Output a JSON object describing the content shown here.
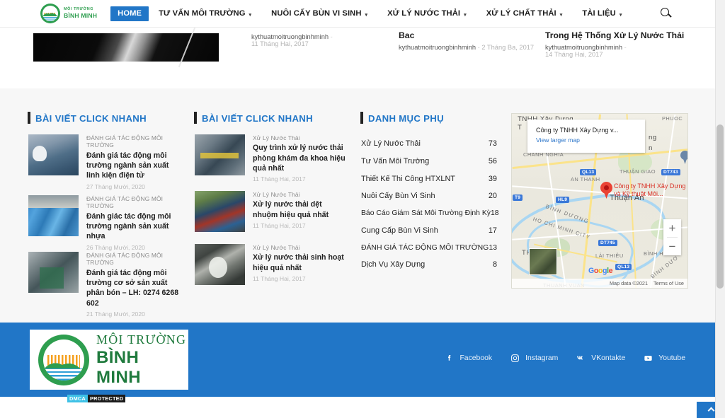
{
  "header": {
    "logo": {
      "line1": "MÔI TRƯỜNG",
      "line2": "BÌNH MINH"
    },
    "nav": [
      {
        "label": "HOME",
        "active": true,
        "caret": ""
      },
      {
        "label": "TƯ VẤN MÔI TRƯỜNG",
        "active": false,
        "caret": "▾"
      },
      {
        "label": "NUÔI CẤY BÙN VI SINH",
        "active": false,
        "caret": "▾"
      },
      {
        "label": "XỬ LÝ NƯỚC THẢI",
        "active": false,
        "caret": "▾"
      },
      {
        "label": "XỬ LÝ CHẤT THẢI",
        "active": false,
        "caret": "▾"
      },
      {
        "label": "TÀI LIỆU",
        "active": false,
        "caret": "▾"
      }
    ],
    "search_icon": "search-icon"
  },
  "top_posts": [
    {
      "author": "kythuatmoitruongbinhminh",
      "sep": "-",
      "date": "11 Tháng Hai, 2017"
    },
    {
      "title_fragment": "Bac",
      "author": "kythuatmoitruongbinhminh",
      "sep": "-",
      "date": "2 Tháng Ba, 2017"
    },
    {
      "title_fragment": "Trong Hệ Thống Xử Lý Nước Thải",
      "author": "kythuatmoitruongbinhminh",
      "sep": "-",
      "date": "14 Tháng Hai, 2017"
    }
  ],
  "widget_col1": {
    "title": "BÀI VIẾT CLICK NHANH",
    "posts": [
      {
        "category": "ĐÁNH GIÁ TÁC ĐỘNG MÔI TRƯỜNG",
        "title": "Đánh giá tác động môi trường ngành sản xuất linh kiện điện tử",
        "date": "27 Tháng Mười, 2020"
      },
      {
        "category": "ĐÁNH GIÁ TÁC ĐỘNG MÔI TRƯỜNG",
        "title": "Đánh giác tác động môi trường ngành sản xuất nhựa",
        "date": "26 Tháng Mười, 2020"
      },
      {
        "category": "ĐÁNH GIÁ TÁC ĐỘNG MÔI TRƯỜNG",
        "title": "Đánh giá tác động môi trường cơ sở sản xuất phân bón – LH: 0274 6268 602",
        "date": "21 Tháng Mười, 2020"
      }
    ]
  },
  "widget_col2": {
    "title": "BÀI VIẾT CLICK NHANH",
    "posts": [
      {
        "category": "Xử Lý Nước Thải",
        "title": "Quy trình xử lý nước thải phòng khám đa khoa hiệu quả nhất",
        "date": "11 Tháng Hai, 2017"
      },
      {
        "category": "Xử Lý Nước Thải",
        "title": "Xử lý nước thải dệt nhuộm hiệu quả nhất",
        "date": "11 Tháng Hai, 2017"
      },
      {
        "category": "Xử Lý Nước Thải",
        "title": "Xử lý nước thải sinh hoạt hiệu quả nhất",
        "date": "11 Tháng Hai, 2017"
      }
    ]
  },
  "widget_col3": {
    "title": "DANH MỤC PHỤ",
    "categories": [
      {
        "name": "Xử Lý Nước Thải",
        "count": "73"
      },
      {
        "name": "Tư Vấn Môi Trường",
        "count": "56"
      },
      {
        "name": "Thiết Kế Thi Công HTXLNT",
        "count": "39"
      },
      {
        "name": "Nuôi Cấy Bùn Vi Sinh",
        "count": "20"
      },
      {
        "name": "Báo Cáo Giám Sát Môi Trường Định Kỳ",
        "count": "18"
      },
      {
        "name": "Cung Cấp Bùn Vi Sinh",
        "count": "17"
      },
      {
        "name": "ĐÁNH GIÁ TÁC ĐỘNG MÔI TRƯỜNG",
        "count": "13"
      },
      {
        "name": "Dịch Vụ Xây Dựng",
        "count": "8"
      }
    ]
  },
  "map": {
    "infowindow_title": "Công ty TNHH Xây Dựng v...",
    "infowindow_link": "View larger map",
    "pin_label": "Công ty TNHH Xây Dựng và Kỹ thuật Môi...",
    "labels": {
      "top_left_1": "TNHH Xây Dựng",
      "top_left_2": "T",
      "chanh_nghia": "CHÁNH NGHĨA",
      "an_thanh": "AN THANH",
      "thuan_giao": "THUẬN GIAO",
      "phuoc": "PHUOC",
      "thuan_an": "Thuận An",
      "lai_thieu": "LÁI THIÊU",
      "binh_hoa": "BÌNH HOÀ",
      "binh_duong_road": "BÌNH DƯƠNG",
      "hcm_city": "HO CHI MINH CITY",
      "binh_duong_2": "BÌNH DƯƠ",
      "thanh": "THANH",
      "thanh_vuan": "THUANH VUAN",
      "ng": "ng",
      "n": "n"
    },
    "shields": [
      "QL13",
      "DT743",
      "T9",
      "HL9",
      "DT745",
      "QL13"
    ],
    "watermark": "Google",
    "attribution": "Map data ©2021",
    "terms": "Terms of Use",
    "zoom_in": "+",
    "zoom_out": "−"
  },
  "footer": {
    "logo": {
      "line1": "MÔI TRƯỜNG",
      "line2": "BÌNH MINH"
    },
    "dmca": {
      "left": "DMCA",
      "right": "PROTECTED"
    },
    "socials": [
      {
        "label": "Facebook",
        "icon": "facebook-icon",
        "glyph": "f"
      },
      {
        "label": "Instagram",
        "icon": "instagram-icon",
        "glyph": "◙"
      },
      {
        "label": "VKontakte",
        "icon": "vkontakte-icon",
        "glyph": "VK"
      },
      {
        "label": "Youtube",
        "icon": "youtube-icon",
        "glyph": "▶"
      }
    ]
  },
  "colors": {
    "brand_blue": "#2176c7",
    "brand_green": "#2e9e4f",
    "widget_bg": "#f7f7f7",
    "map_pin": "#ea4335"
  }
}
